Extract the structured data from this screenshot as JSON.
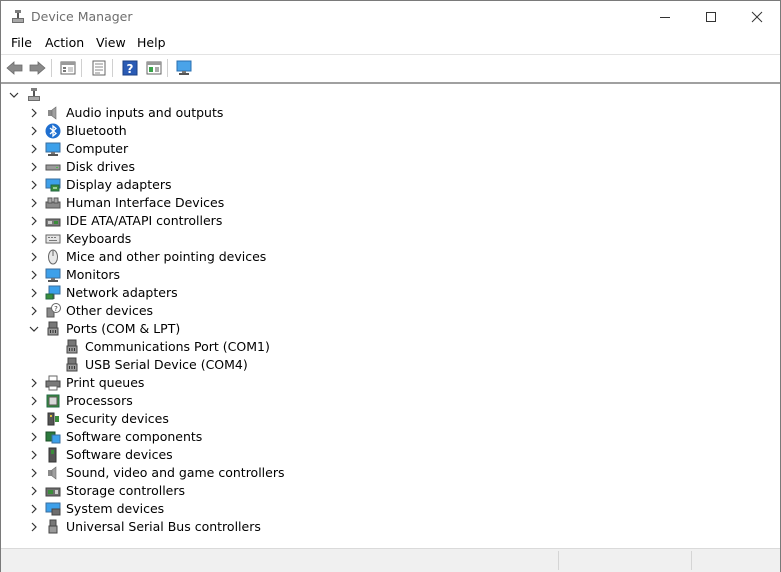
{
  "window": {
    "title": "Device Manager"
  },
  "menu": [
    "File",
    "Action",
    "View",
    "Help"
  ],
  "toolbar": {
    "buttons": [
      "back-arrow-icon",
      "forward-arrow-icon",
      "show-hide-tree-icon",
      "properties-icon",
      "help-icon",
      "update-driver-icon",
      "scan-hardware-icon"
    ]
  },
  "tree": {
    "root_label": "",
    "categories": [
      {
        "label": "Audio inputs and outputs",
        "icon": "speaker-icon",
        "expanded": false
      },
      {
        "label": "Bluetooth",
        "icon": "bluetooth-icon",
        "expanded": false
      },
      {
        "label": "Computer",
        "icon": "computer-monitor-icon",
        "expanded": false
      },
      {
        "label": "Disk drives",
        "icon": "disk-drive-icon",
        "expanded": false
      },
      {
        "label": "Display adapters",
        "icon": "display-adapter-icon",
        "expanded": false
      },
      {
        "label": "Human Interface Devices",
        "icon": "hid-icon",
        "expanded": false
      },
      {
        "label": "IDE ATA/ATAPI controllers",
        "icon": "ide-controller-icon",
        "expanded": false
      },
      {
        "label": "Keyboards",
        "icon": "keyboard-icon",
        "expanded": false
      },
      {
        "label": "Mice and other pointing devices",
        "icon": "mouse-icon",
        "expanded": false
      },
      {
        "label": "Monitors",
        "icon": "monitor-icon",
        "expanded": false
      },
      {
        "label": "Network adapters",
        "icon": "network-adapter-icon",
        "expanded": false
      },
      {
        "label": "Other devices",
        "icon": "unknown-device-icon",
        "expanded": false
      },
      {
        "label": "Ports (COM & LPT)",
        "icon": "port-icon",
        "expanded": true,
        "children": [
          {
            "label": "Communications Port (COM1)",
            "icon": "port-icon"
          },
          {
            "label": "USB Serial Device (COM4)",
            "icon": "port-icon"
          }
        ]
      },
      {
        "label": "Print queues",
        "icon": "printer-icon",
        "expanded": false
      },
      {
        "label": "Processors",
        "icon": "processor-icon",
        "expanded": false
      },
      {
        "label": "Security devices",
        "icon": "security-device-icon",
        "expanded": false
      },
      {
        "label": "Software components",
        "icon": "software-component-icon",
        "expanded": false
      },
      {
        "label": "Software devices",
        "icon": "software-device-icon",
        "expanded": false
      },
      {
        "label": "Sound, video and game controllers",
        "icon": "sound-controller-icon",
        "expanded": false
      },
      {
        "label": "Storage controllers",
        "icon": "storage-controller-icon",
        "expanded": false
      },
      {
        "label": "System devices",
        "icon": "system-devices-icon",
        "expanded": false
      },
      {
        "label": "Universal Serial Bus controllers",
        "icon": "usb-icon",
        "expanded": false
      }
    ]
  },
  "colors": {
    "accent": "#0078d7",
    "title_text": "#6e6e6e"
  }
}
